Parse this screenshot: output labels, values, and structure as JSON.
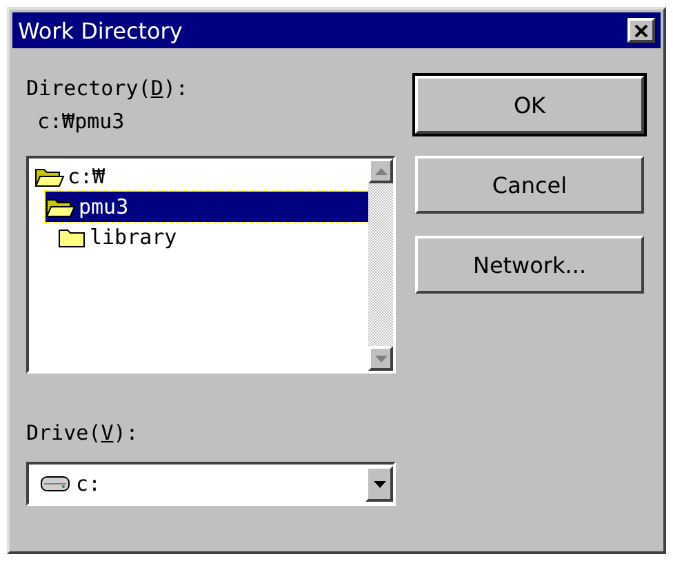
{
  "window": {
    "title": "Work Directory"
  },
  "directory": {
    "label": {
      "before": "Directory(",
      "key": "D",
      "after": "):"
    },
    "path": "c:₩pmu3",
    "tree": [
      {
        "name": "c:₩",
        "expanded": true,
        "selected": false,
        "children": [
          {
            "name": "pmu3",
            "expanded": true,
            "selected": true,
            "children": [
              {
                "name": "library",
                "expanded": false,
                "selected": false
              }
            ]
          }
        ]
      }
    ]
  },
  "drive": {
    "label": {
      "before": "Drive(",
      "key": "V",
      "after": "):"
    },
    "value": "c:"
  },
  "buttons": [
    {
      "label": "OK",
      "default": true
    },
    {
      "label": "Cancel",
      "default": false
    },
    {
      "label": "Network...",
      "default": false
    }
  ]
}
